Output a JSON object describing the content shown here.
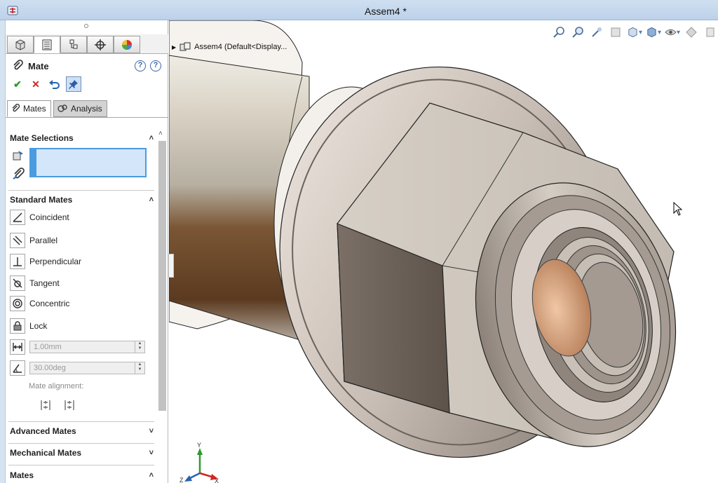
{
  "window": {
    "title": "Assem4 *",
    "app_icon": "solidworks-logo-icon"
  },
  "manager_tabs": [
    {
      "name": "featuremanager-tab",
      "icon": "cube-icon"
    },
    {
      "name": "propertymanager-tab",
      "icon": "list-icon"
    },
    {
      "name": "configurationmanager-tab",
      "icon": "config-icon"
    },
    {
      "name": "dimxpert-tab",
      "icon": "crosshair-icon"
    },
    {
      "name": "display-manager-tab",
      "icon": "pie-icon"
    }
  ],
  "property_manager": {
    "title": "Mate",
    "actions": {
      "ok": "✔",
      "cancel": "✕"
    },
    "tabs": [
      {
        "label": "Mates",
        "active": true
      },
      {
        "label": "Analysis",
        "active": false
      }
    ],
    "groups": {
      "mate_selections": "Mate Selections",
      "standard_mates": "Standard Mates",
      "advanced_mates": "Advanced Mates",
      "mechanical_mates": "Mechanical Mates",
      "mates": "Mates"
    },
    "standard_mates": [
      {
        "label": "Coincident",
        "icon": "coincident-icon"
      },
      {
        "label": "Parallel",
        "icon": "parallel-icon"
      },
      {
        "label": "Perpendicular",
        "icon": "perpendicular-icon"
      },
      {
        "label": "Tangent",
        "icon": "tangent-icon"
      },
      {
        "label": "Concentric",
        "icon": "concentric-icon"
      },
      {
        "label": "Lock",
        "icon": "lock-icon"
      }
    ],
    "distance_value": "1.00mm",
    "angle_value": "30.00deg",
    "mate_alignment_label": "Mate alignment:"
  },
  "viewport": {
    "tree_label": "Assem4  (Default<Display...",
    "triad": {
      "y": "Y",
      "z": "Z",
      "x": "X"
    },
    "colors": {
      "nut_metal": "#b4aca4",
      "shaft_metal": "#c8c2b4",
      "shaft_wood": "#6e4a2a",
      "bore_copper": "#d7a17b",
      "selection_blue": "#4a9be0"
    }
  }
}
